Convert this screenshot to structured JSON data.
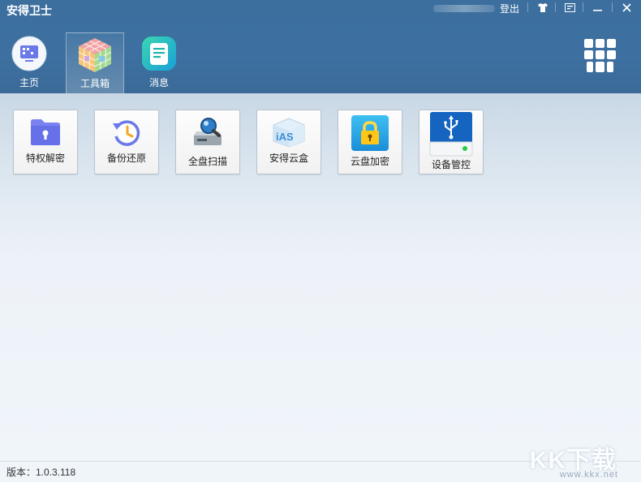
{
  "window": {
    "title": "安得卫士",
    "logout_label": "登出",
    "controls": {
      "skin": "shirt-icon",
      "menu": "menu-icon",
      "minimize": "minimize-icon",
      "close": "close-icon"
    }
  },
  "nav": {
    "tabs": [
      {
        "label": "主页",
        "icon": "home-monitor-icon"
      },
      {
        "label": "工具箱",
        "icon": "toolbox-cube-icon",
        "active": true
      },
      {
        "label": "消息",
        "icon": "message-icon"
      }
    ]
  },
  "tools": [
    {
      "label": "特权解密",
      "icon": "folder-lock-icon"
    },
    {
      "label": "备份还原",
      "icon": "backup-restore-icon"
    },
    {
      "label": "全盘扫描",
      "icon": "disk-scan-icon"
    },
    {
      "label": "安得云盒",
      "icon": "cloud-box-icon",
      "icon_text": "iAS"
    },
    {
      "label": "云盘加密",
      "icon": "cloud-lock-icon"
    },
    {
      "label": "设备管控",
      "icon": "usb-device-icon"
    }
  ],
  "footer": {
    "version": "版本：1.0.3.118"
  },
  "watermark": {
    "text": "KK下载",
    "url": "www.kkx.net"
  },
  "colors": {
    "header": "#3c6f9e",
    "accent": "#2b8fd8"
  }
}
